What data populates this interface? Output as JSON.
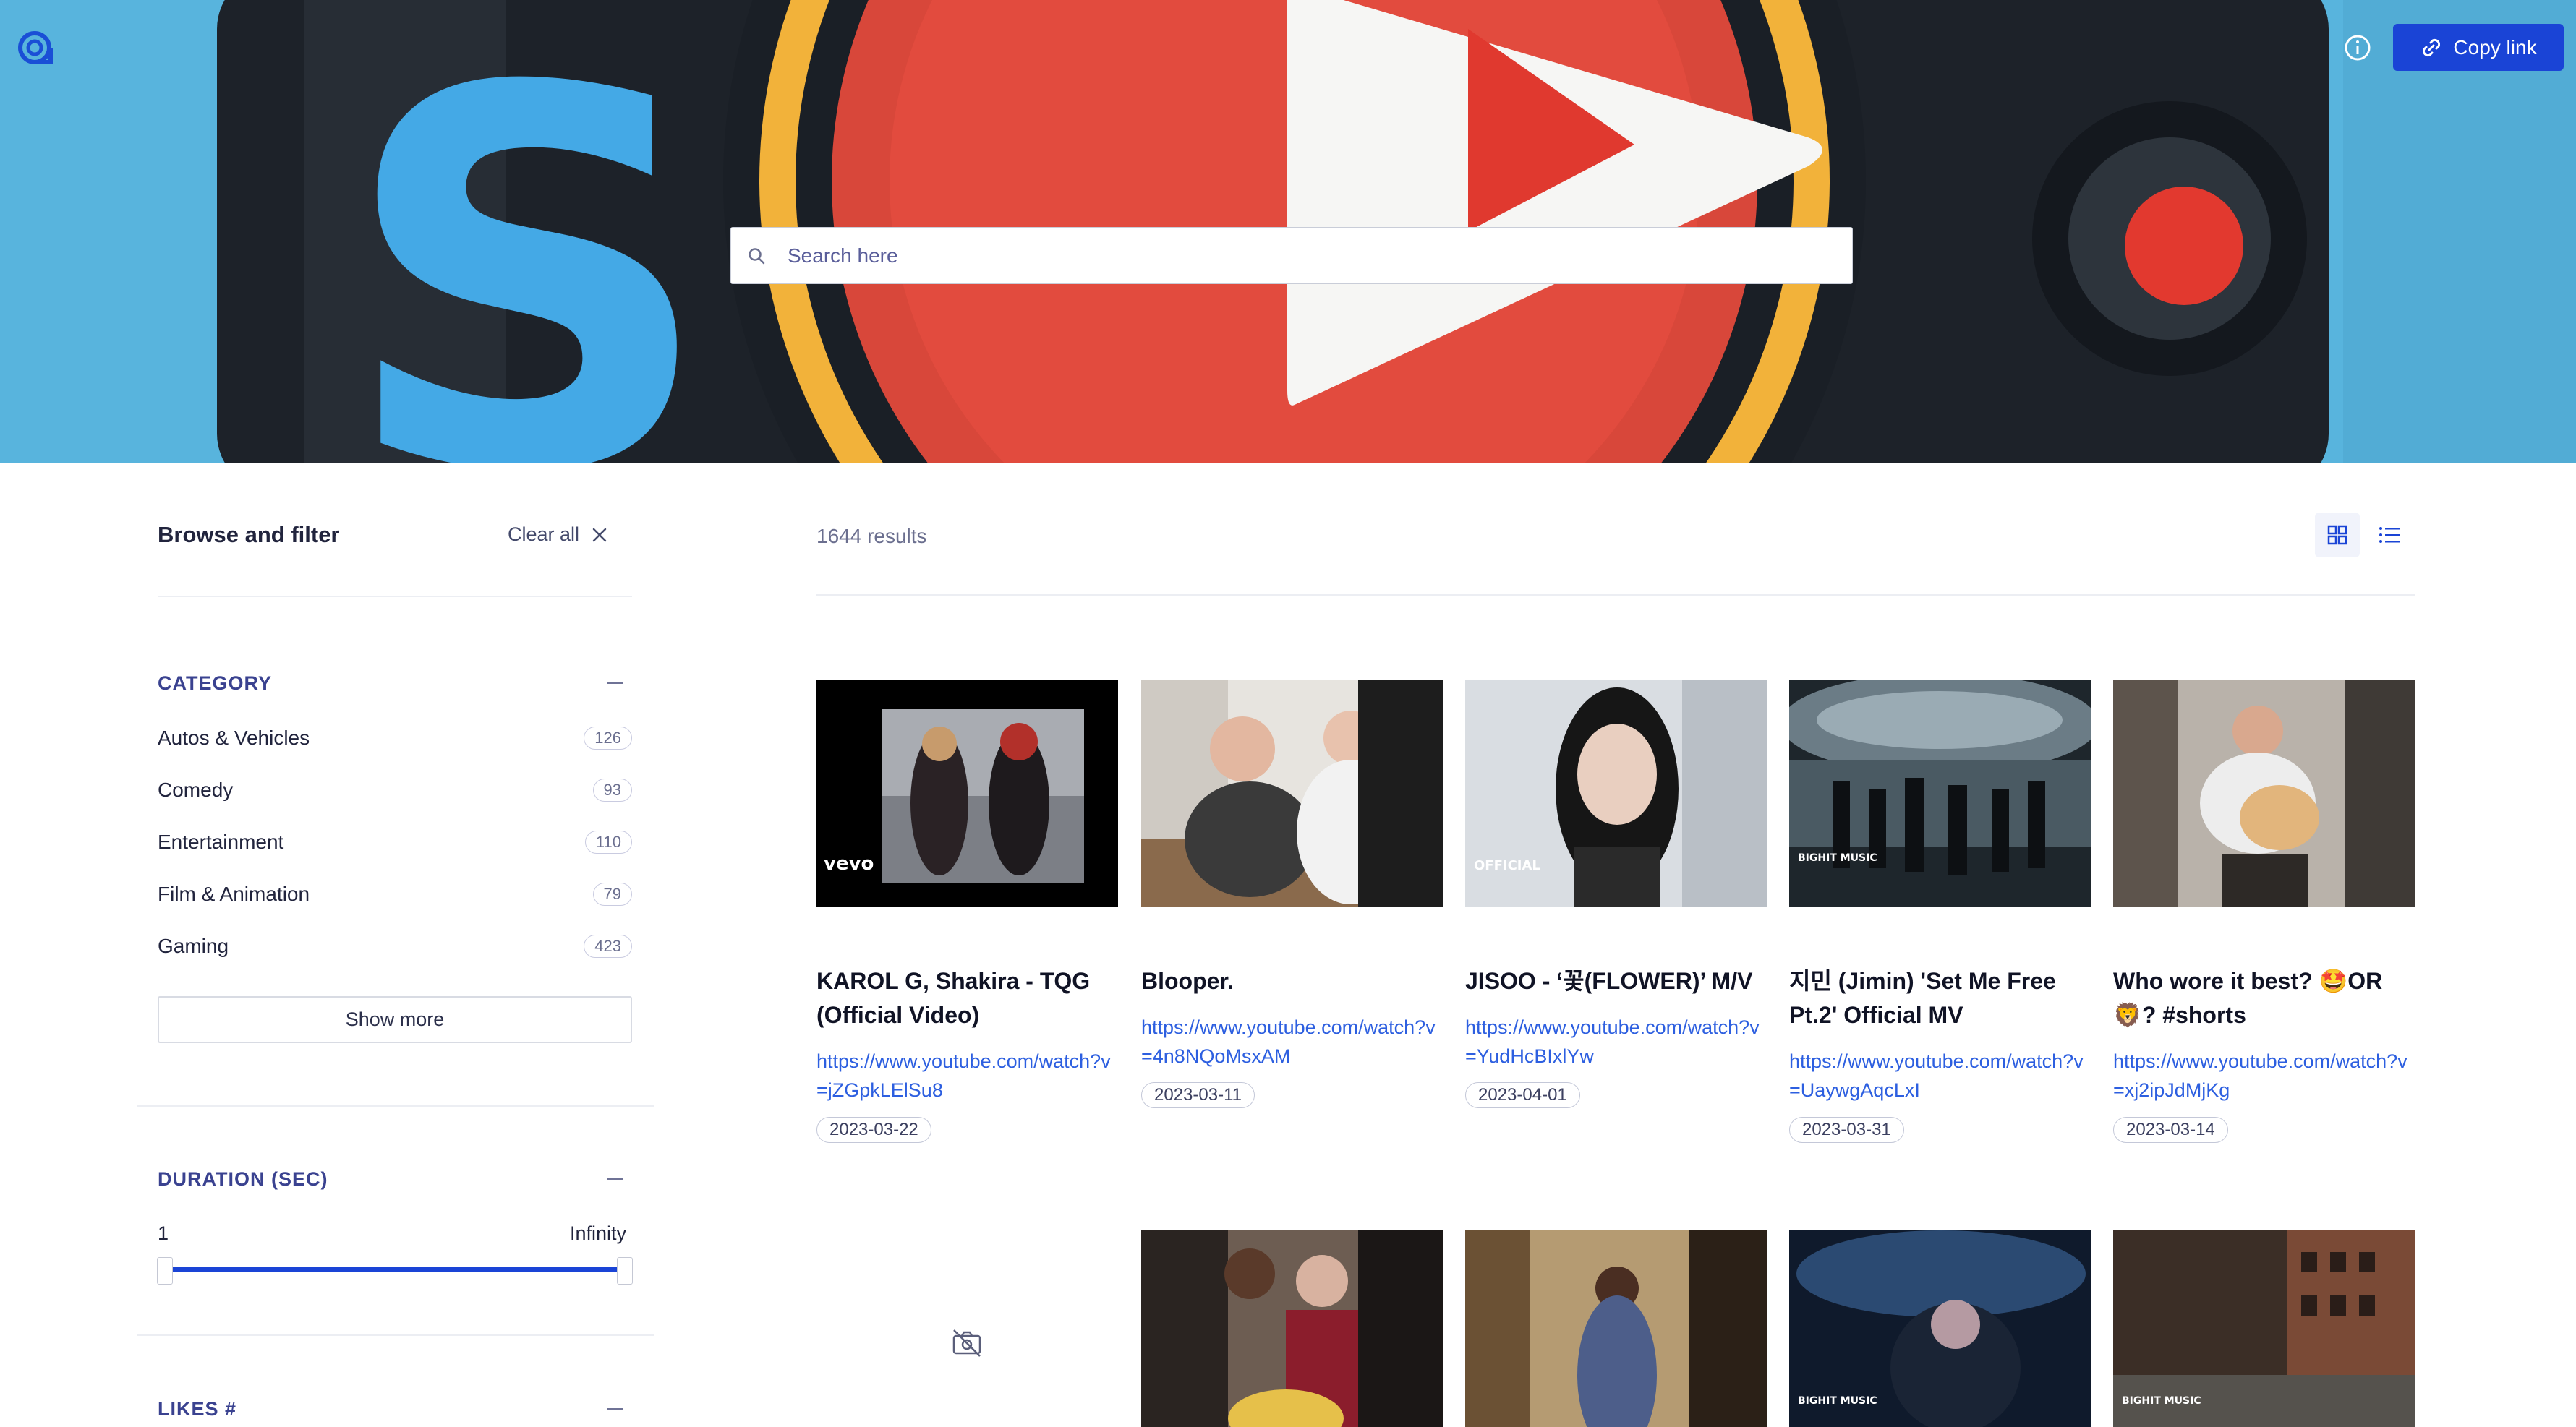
{
  "header": {
    "logo_icon": "algolia-logo-icon",
    "info_icon": "info-icon",
    "copy_link_label": "Copy link",
    "copy_link_icon": "link-icon"
  },
  "search": {
    "placeholder": "Search here",
    "icon": "search-icon"
  },
  "sidebar": {
    "title": "Browse and filter",
    "clear_all_label": "Clear all",
    "category": {
      "title": "CATEGORY",
      "items": [
        {
          "label": "Autos & Vehicles",
          "count": "126"
        },
        {
          "label": "Comedy",
          "count": "93"
        },
        {
          "label": "Entertainment",
          "count": "110"
        },
        {
          "label": "Film & Animation",
          "count": "79"
        },
        {
          "label": "Gaming",
          "count": "423"
        }
      ],
      "show_more_label": "Show more"
    },
    "duration": {
      "title": "DURATION (SEC)",
      "min_label": "1",
      "max_label": "Infinity",
      "range_low_fraction": 0,
      "range_high_fraction": 1
    },
    "likes": {
      "title": "LIKES #"
    }
  },
  "results": {
    "count_label": "1644 results",
    "view_modes": [
      "grid-icon",
      "list-icon"
    ],
    "active_view": "grid-icon",
    "videos": [
      {
        "title": "KAROL G, Shakira - TQG (Official Video)",
        "url": "https://www.youtube.com/watch?v=jZGpkLElSu8",
        "date": "2023-03-22"
      },
      {
        "title": "Blooper.",
        "url": "https://www.youtube.com/watch?v=4n8NQoMsxAM",
        "date": "2023-03-11"
      },
      {
        "title": "JISOO - ‘꽃(FLOWER)’ M/V",
        "url": "https://www.youtube.com/watch?v=YudHcBIxlYw",
        "date": "2023-04-01"
      },
      {
        "title": "지민 (Jimin) 'Set Me Free Pt.2' Official MV",
        "url": "https://www.youtube.com/watch?v=UaywgAqcLxI",
        "date": "2023-03-31"
      },
      {
        "title": "Who wore it best? 🤩OR🦁? #shorts",
        "url": "https://www.youtube.com/watch?v=xj2ipJdMjKg",
        "date": "2023-03-14"
      }
    ],
    "second_row_placeholder_icon": "no-image-icon",
    "thumb_badges": {
      "vevo": "vevo",
      "yg": "OFFICIAL",
      "bighit": "BIGHIT MUSIC"
    }
  }
}
